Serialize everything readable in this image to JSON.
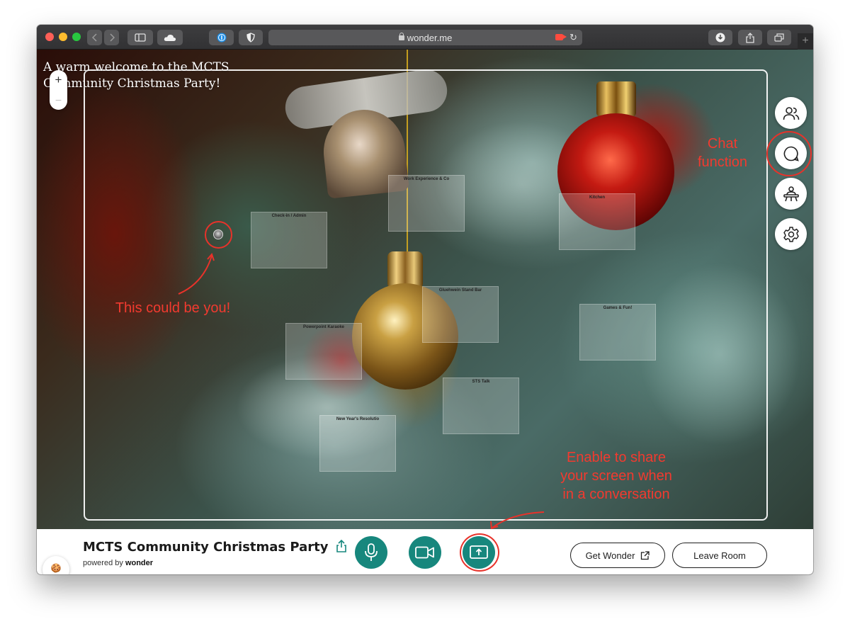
{
  "browser": {
    "url": "wonder.me",
    "new_tab_symbol": "+"
  },
  "scene": {
    "welcome_line1": "A warm welcome to the MCTS",
    "welcome_line2": "Community Christmas Party!",
    "zoom_in": "+",
    "zoom_out": "–"
  },
  "rooms": [
    {
      "label": "Check-in / Admin"
    },
    {
      "label": "Work Experience & Co"
    },
    {
      "label": "Kitchen"
    },
    {
      "label": "Gluehwein Stand Bar"
    },
    {
      "label": "Games & Fun!"
    },
    {
      "label": "Powerpoint Karaoke"
    },
    {
      "label": "STS Talk"
    },
    {
      "label": "New Year's Resolutio"
    }
  ],
  "annotations": {
    "chat": "Chat\nfunction",
    "avatar": "This could be you!",
    "share_screen": "Enable to share\nyour screen when\nin a conversation",
    "color": "#f23a2f"
  },
  "sidebar": {
    "icons": [
      "people-icon",
      "chat-icon",
      "broadcast-icon",
      "settings-icon"
    ]
  },
  "bottom_bar": {
    "title": "MCTS Community Christmas Party",
    "powered_by_prefix": "powered by",
    "powered_by_brand": "wonder",
    "get_wonder_label": "Get Wonder",
    "leave_room_label": "Leave Room",
    "accent_color": "#17877d",
    "cookie_glyph": "🍪"
  }
}
